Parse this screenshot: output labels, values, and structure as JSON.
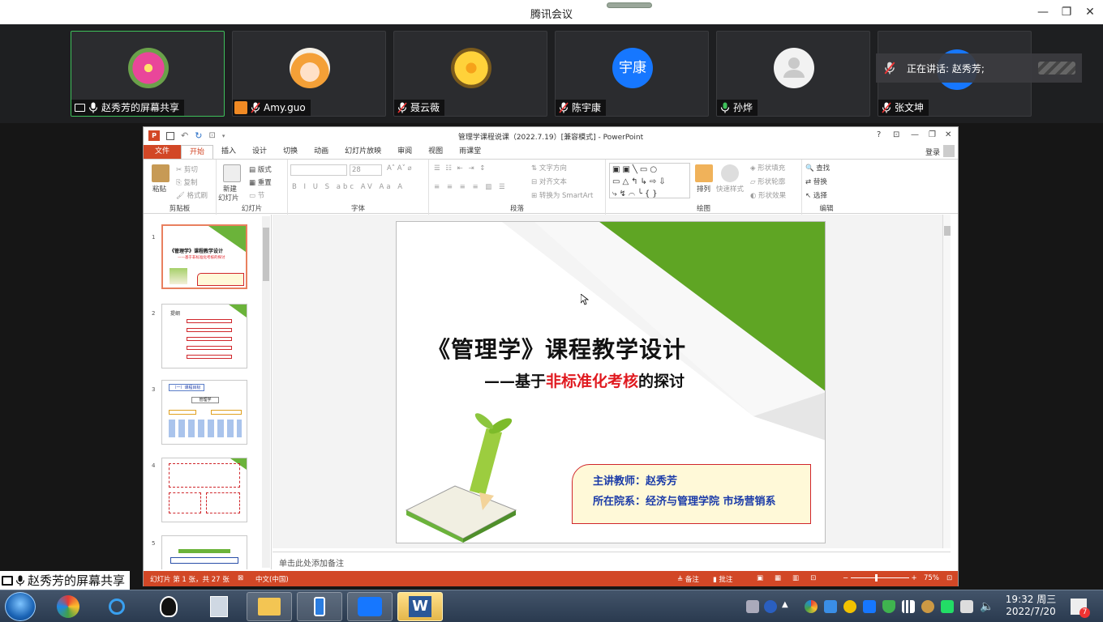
{
  "app": {
    "title": "腾讯会议"
  },
  "participants": [
    {
      "name": "赵秀芳的屏幕共享",
      "avatar": "flower-pink",
      "active": true
    },
    {
      "name": "Amy.guo",
      "avatar": "cartoon-girl"
    },
    {
      "name": "聂云薇",
      "avatar": "flower-yellow"
    },
    {
      "name": "陈宇康",
      "avatar": "text",
      "initials": "宇康"
    },
    {
      "name": "孙烨",
      "avatar": "default-person"
    },
    {
      "name": "张文坤",
      "avatar": "blue"
    }
  ],
  "speaking": {
    "label": "正在讲话: 赵秀芳;"
  },
  "share_label": "赵秀芳的屏幕共享",
  "powerpoint": {
    "window_title": "管理学课程说课（2022.7.19）[兼容模式] - PowerPoint",
    "login": "登录",
    "tabs": [
      "文件",
      "开始",
      "插入",
      "设计",
      "切换",
      "动画",
      "幻灯片放映",
      "审阅",
      "视图",
      "雨课堂"
    ],
    "ribbon": {
      "clipboard": {
        "label": "剪贴板",
        "paste": "粘贴",
        "cut": "剪切",
        "copy": "复制",
        "format_painter": "格式刷"
      },
      "slides": {
        "label": "幻灯片",
        "new_slide_1": "新建",
        "new_slide_2": "幻灯片",
        "layout": "版式",
        "reset": "重置",
        "section": "节"
      },
      "font": {
        "label": "字体",
        "font_size": "28"
      },
      "paragraph": {
        "label": "段落",
        "text_direction": "文字方向",
        "align_text": "对齐文本",
        "smartart": "转换为 SmartArt"
      },
      "drawing": {
        "label": "绘图",
        "arrange": "排列",
        "quick_styles": "快速样式",
        "shape_fill": "形状填充",
        "shape_outline": "形状轮廓",
        "shape_effects": "形状效果"
      },
      "editing": {
        "label": "编辑",
        "find": "查找",
        "replace": "替换",
        "select": "选择"
      }
    },
    "slide": {
      "title": "《管理学》课程教学设计",
      "subtitle_prefix": "——基于",
      "subtitle_highlight": "非标准化考核",
      "subtitle_suffix": "的探讨",
      "teacher": "主讲教师：赵秀芳",
      "department": "所在院系：经济与管理学院 市场营销系"
    },
    "thumb1": {
      "title": "《管理学》课程教学设计",
      "subtitle": "——基于非标准化考核的探讨"
    },
    "thumb2": {
      "title": "提纲"
    },
    "thumb3": {
      "title": "（一）课程目标",
      "box": "管理学"
    },
    "notes_placeholder": "单击此处添加备注",
    "status": {
      "slide_count": "幻灯片 第 1 张，共 27 张",
      "language": "中文(中国)",
      "notes": "备注",
      "comments": "批注",
      "zoom": "75%"
    }
  },
  "taskbar": {
    "time": "19:32 周三",
    "date": "2022/7/20",
    "badge": "7"
  }
}
